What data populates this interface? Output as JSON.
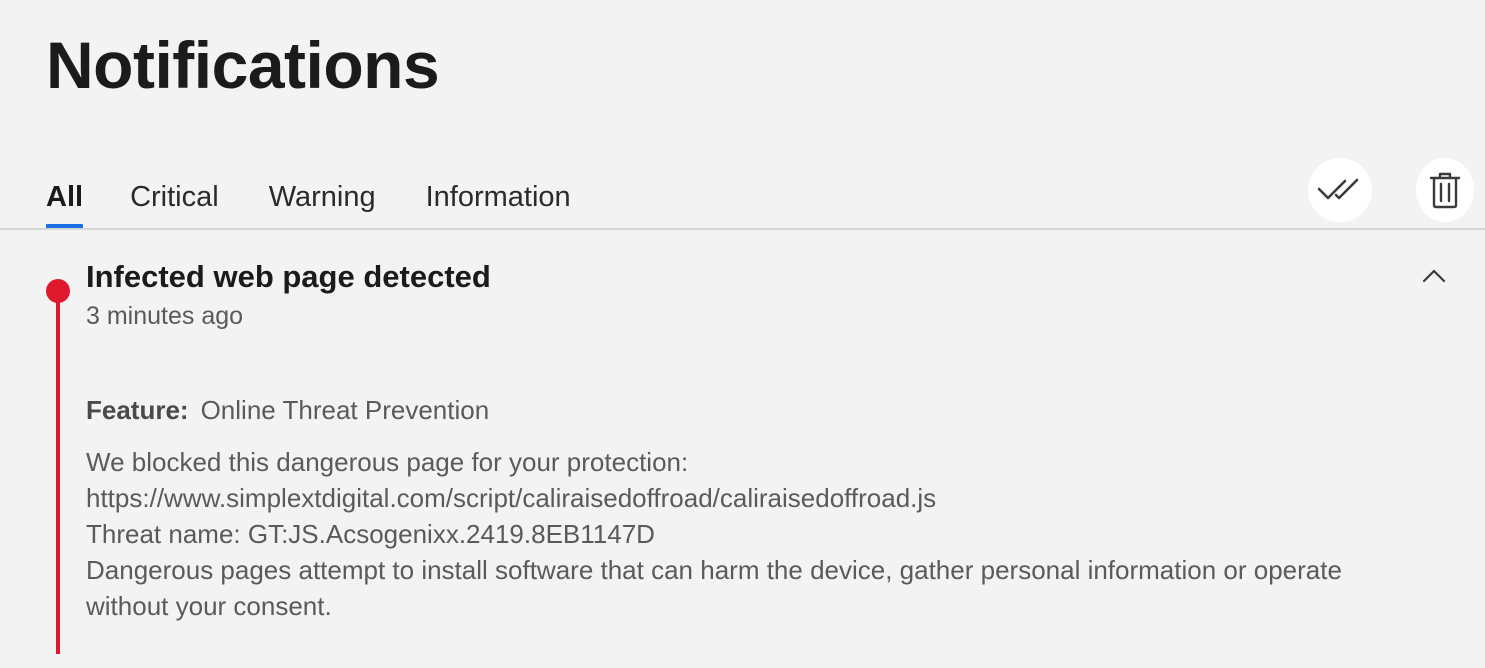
{
  "page": {
    "title": "Notifications"
  },
  "tabs": [
    {
      "label": "All",
      "active": true
    },
    {
      "label": "Critical",
      "active": false
    },
    {
      "label": "Warning",
      "active": false
    },
    {
      "label": "Information",
      "active": false
    }
  ],
  "toolbar": {
    "mark_all_read_icon": "double-check-icon",
    "delete_icon": "trash-icon"
  },
  "notification": {
    "severity": "critical",
    "severity_color": "#e0182d",
    "title": "Infected web page detected",
    "time": "3 minutes ago",
    "feature_label": "Feature:",
    "feature_value": "Online Threat Prevention",
    "body_lines": [
      "We blocked this dangerous page for your protection:",
      "https://www.simplextdigital.com/script/caliraisedoffroad/caliraisedoffroad.js",
      "Threat name: GT:JS.Acsogenixx.2419.8EB1147D",
      "Dangerous pages attempt to install software that can harm the device, gather personal information or operate",
      "without your consent."
    ],
    "collapse_icon": "chevron-up-icon"
  },
  "colors": {
    "accent": "#1a6fe3",
    "critical": "#e0182d",
    "background": "#f3f3f3"
  }
}
